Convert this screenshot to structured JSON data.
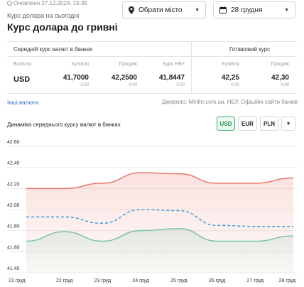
{
  "header": {
    "updated": "Оновлено 27.12.2024, 15:35",
    "subtitle": "Курс долара на сьогодні",
    "title": "Курс долара до гривні",
    "city_select": "Обрати місто",
    "date_select": "28 грудня"
  },
  "table": {
    "bank_section": "Середній курс валют в банках",
    "cash_section": "Готівковий курс",
    "col_currency": "Валюта",
    "col_buy": "Купівля",
    "col_sell": "Продаж",
    "col_nbu": "Курс НБУ",
    "col_cash_buy": "Купівля",
    "col_cash_sell": "Продаж",
    "currency": "USD",
    "bank_buy": "41,7000",
    "bank_buy_change": "0.00",
    "bank_sell": "42,2500",
    "bank_sell_change": "0.00",
    "nbu": "41,8447",
    "nbu_change": "0.00",
    "cash_buy": "42,25",
    "cash_buy_change": "0.00",
    "cash_sell": "42,30",
    "cash_sell_change": "0.00"
  },
  "links": {
    "other_currencies": "Інші валюти",
    "source": "Джерело: Minfin.com.ua, НБУ, Офіційні сайти банків"
  },
  "chart_controls": {
    "title": "Динаміка середнього курсу валют в банках",
    "usd": "USD",
    "eur": "EUR",
    "pln": "PLN",
    "more": "▾"
  },
  "colors": {
    "sell": "#e8786c",
    "nbu": "#3a9ee0",
    "buy": "#7cc4a2",
    "accent": "#33b06a"
  },
  "chart_data": {
    "type": "line",
    "categories": [
      "21 груд",
      "22 груд",
      "23 груд",
      "24 груд",
      "25 груд",
      "26 груд",
      "27 груд",
      "28 груд"
    ],
    "yticks": [
      "42.60",
      "42.40",
      "42.20",
      "42.00",
      "41.80",
      "41.60",
      "41.40"
    ],
    "ylim": [
      41.4,
      42.6
    ],
    "series": [
      {
        "key": "sell",
        "style": "solid",
        "values": [
          42.2,
          42.2,
          42.25,
          42.35,
          42.34,
          42.25,
          42.25,
          42.3
        ]
      },
      {
        "key": "nbu",
        "style": "dashed",
        "values": [
          41.93,
          41.93,
          41.87,
          42.0,
          41.99,
          41.85,
          41.84,
          41.84
        ]
      },
      {
        "key": "buy",
        "style": "solid",
        "values": [
          41.7,
          41.79,
          41.7,
          41.8,
          41.82,
          41.7,
          41.7,
          41.75
        ]
      }
    ]
  }
}
